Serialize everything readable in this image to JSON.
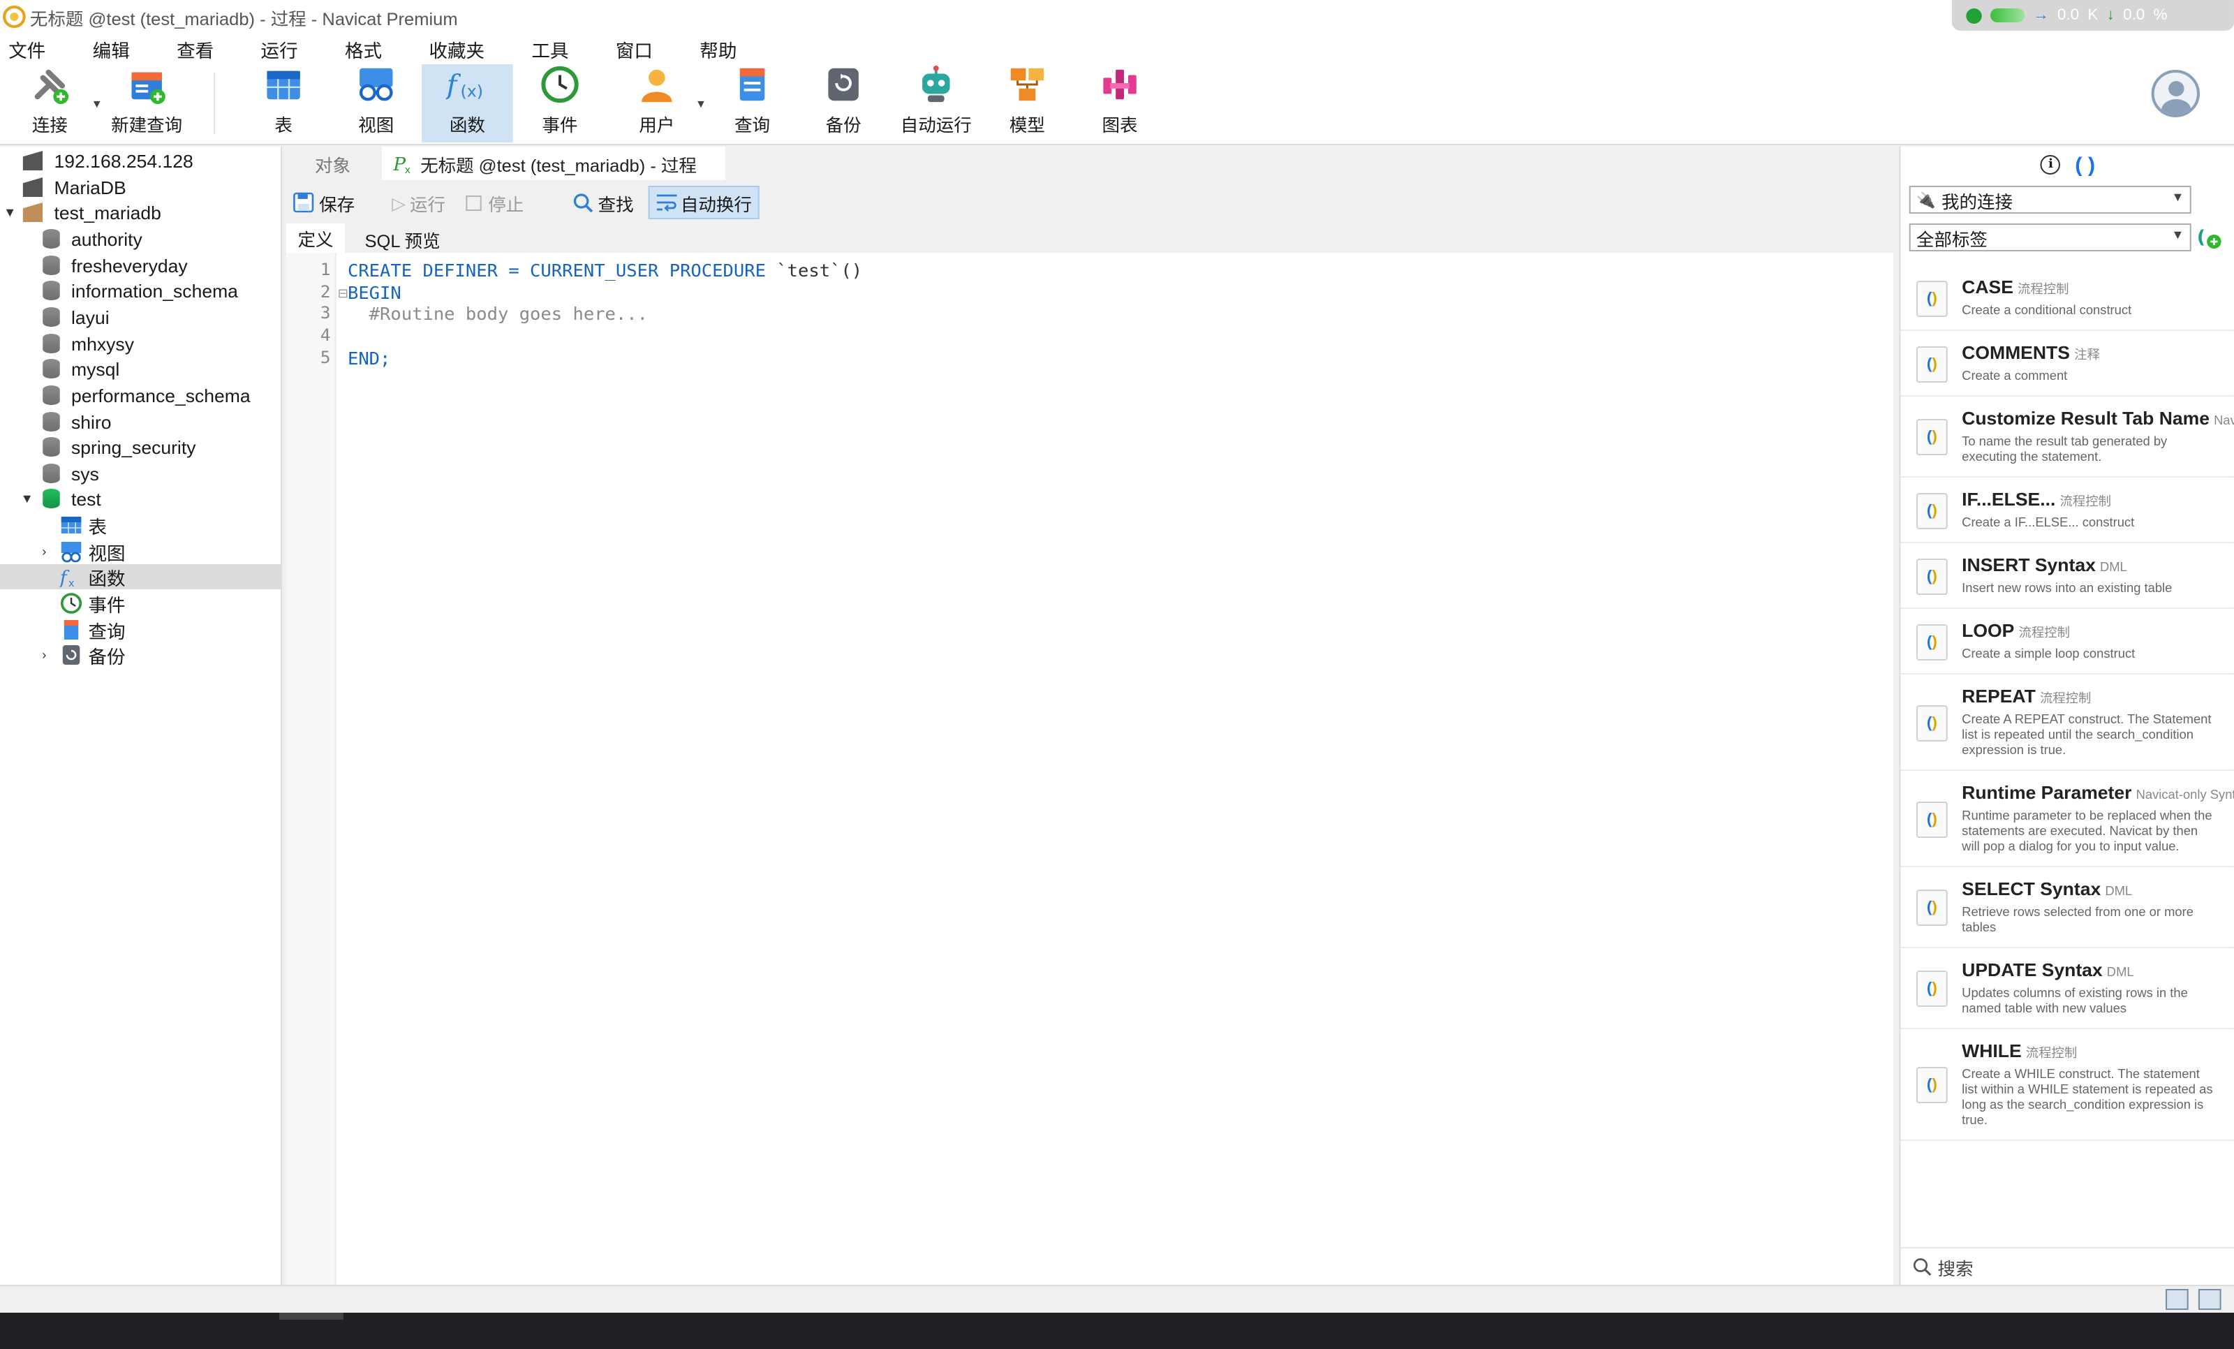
{
  "window": {
    "title": "无标题 @test (test_mariadb) - 过程 - Navicat Premium"
  },
  "network_widget": {
    "up": "0.0",
    "down": "0.0",
    "up_unit": "K",
    "down_unit": "%"
  },
  "menu": [
    "文件",
    "编辑",
    "查看",
    "运行",
    "格式",
    "收藏夹",
    "工具",
    "窗口",
    "帮助"
  ],
  "toolbar": {
    "connect": "连接",
    "new_query": "新建查询",
    "table": "表",
    "view": "视图",
    "function": "函数",
    "event": "事件",
    "user": "用户",
    "query": "查询",
    "backup": "备份",
    "automation": "自动运行",
    "model": "模型",
    "chart": "图表"
  },
  "tree": {
    "connections": [
      "192.168.254.128",
      "MariaDB",
      "test_mariadb"
    ],
    "databases": [
      "authority",
      "fresheveryday",
      "information_schema",
      "layui",
      "mhxysy",
      "mysql",
      "performance_schema",
      "shiro",
      "spring_security",
      "sys",
      "test"
    ],
    "test_children": [
      "表",
      "视图",
      "函数",
      "事件",
      "查询",
      "备份"
    ],
    "selected": "函数"
  },
  "editor": {
    "tab_objects": "对象",
    "tab_active": "无标题 @test (test_mariadb) - 过程",
    "save": "保存",
    "run": "运行",
    "stop": "停止",
    "find": "查找",
    "wrap": "自动换行",
    "subtab_def": "定义",
    "subtab_sql": "SQL 预览",
    "line_numbers": [
      "1",
      "2",
      "3",
      "4",
      "5"
    ],
    "line1_kw": "CREATE DEFINER = CURRENT_USER PROCEDURE",
    "line1_name": " `test`()",
    "line2": "BEGIN",
    "line3": "  #Routine body goes here...",
    "line5": "END;"
  },
  "right_panel": {
    "connection_combo": "我的连接",
    "tag_combo": "全部标签",
    "search_placeholder": "搜索",
    "snippets": [
      {
        "name": "CASE",
        "category": "流程控制",
        "desc": "Create a conditional construct"
      },
      {
        "name": "COMMENTS",
        "category": "注释",
        "desc": "Create a comment"
      },
      {
        "name": "Customize Result Tab Name",
        "category": "Navicat-only Syntax",
        "desc": "To name the result tab generated by executing the statement."
      },
      {
        "name": "IF...ELSE...",
        "category": "流程控制",
        "desc": "Create a IF...ELSE... construct"
      },
      {
        "name": "INSERT Syntax",
        "category": "DML",
        "desc": "Insert new rows into an existing table"
      },
      {
        "name": "LOOP",
        "category": "流程控制",
        "desc": "Create a simple loop construct"
      },
      {
        "name": "REPEAT",
        "category": "流程控制",
        "desc": "Create A REPEAT construct. The Statement list is repeated until the search_condition expression is true."
      },
      {
        "name": "Runtime Parameter",
        "category": "Navicat-only Syntax",
        "desc": "Runtime parameter to be replaced when the statements are executed. Navicat by then will pop a dialog for you to input value."
      },
      {
        "name": "SELECT Syntax",
        "category": "DML",
        "desc": "Retrieve rows selected from one or more tables"
      },
      {
        "name": "UPDATE Syntax",
        "category": "DML",
        "desc": "Updates columns of existing rows in the named table with new values"
      },
      {
        "name": "WHILE",
        "category": "流程控制",
        "desc": "Create a WHILE construct. The statement list within a WHILE statement is repeated as long as the search_condition expression is true."
      }
    ]
  },
  "colors": {
    "accent": "#1a73e8",
    "selected_tool": "#cfe3f5",
    "keyword": "#1565c0"
  }
}
